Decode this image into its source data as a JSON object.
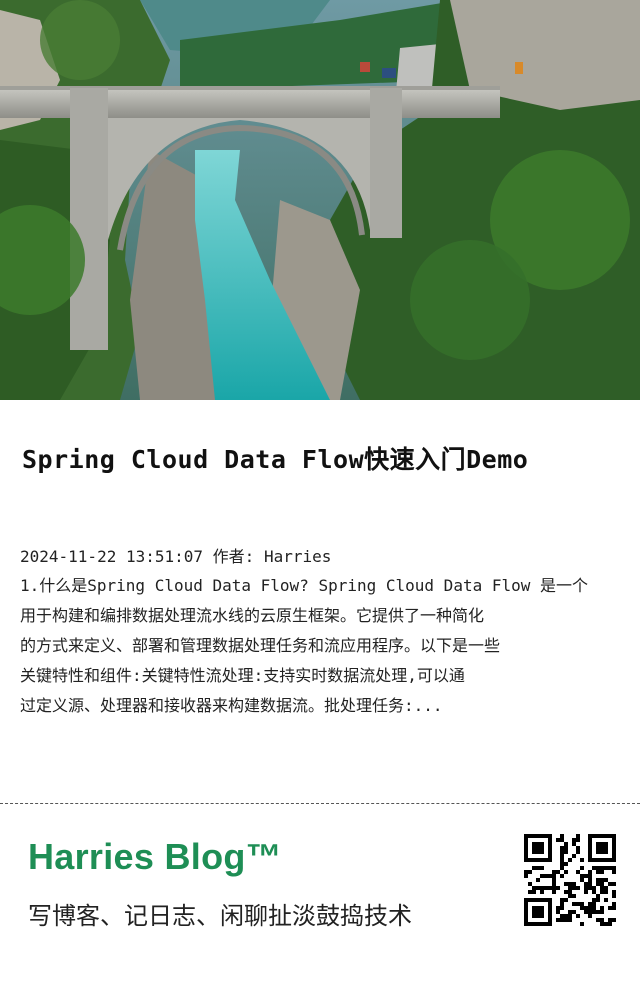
{
  "post": {
    "title": "Spring Cloud Data Flow快速入门Demo",
    "datetime": "2024-11-22 13:51:07",
    "author_label": "作者:",
    "author": "Harries",
    "excerpt_lines": [
      "1.什么是Spring Cloud Data Flow? Spring Cloud Data Flow 是一个",
      "用于构建和编排数据处理流水线的云原生框架。它提供了一种简化",
      "的方式来定义、部署和管理数据处理任务和流应用程序。以下是一些",
      "关键特性和组件:关键特性流处理:支持实时数据流处理,可以通",
      "过定义源、处理器和接收器来构建数据流。批处理任务:..."
    ]
  },
  "footer": {
    "brand": "Harries Blog™",
    "slogan": "写博客、记日志、闲聊扯淡鼓捣技术"
  },
  "colors": {
    "brand_green": "#1e8e55",
    "text": "#222222",
    "divider": "#555555"
  },
  "icons": {
    "qr": "qr-code-icon",
    "hero": "bridge-canyon-photo"
  }
}
